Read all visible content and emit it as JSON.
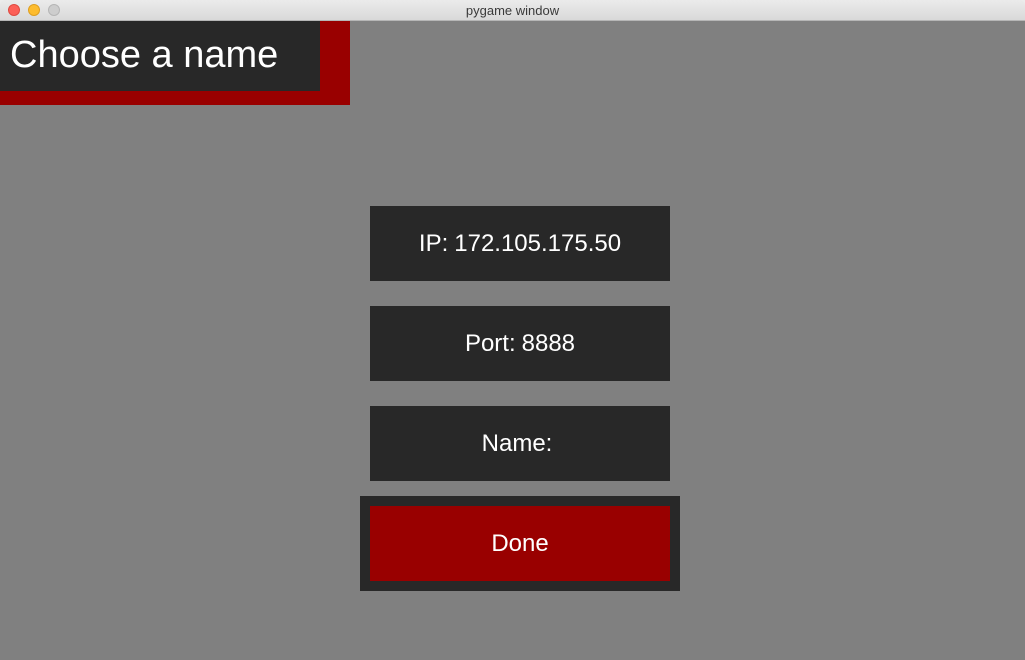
{
  "window": {
    "title": "pygame window"
  },
  "header": {
    "title": "Choose a name"
  },
  "form": {
    "ip": {
      "label": "IP:",
      "value": "172.105.175.50"
    },
    "port": {
      "label": "Port:",
      "value": "8888"
    },
    "name": {
      "label": "Name:",
      "value": ""
    },
    "done_label": "Done"
  },
  "colors": {
    "background": "#808080",
    "panel": "#282828",
    "accent": "#990000",
    "text": "#ffffff"
  }
}
